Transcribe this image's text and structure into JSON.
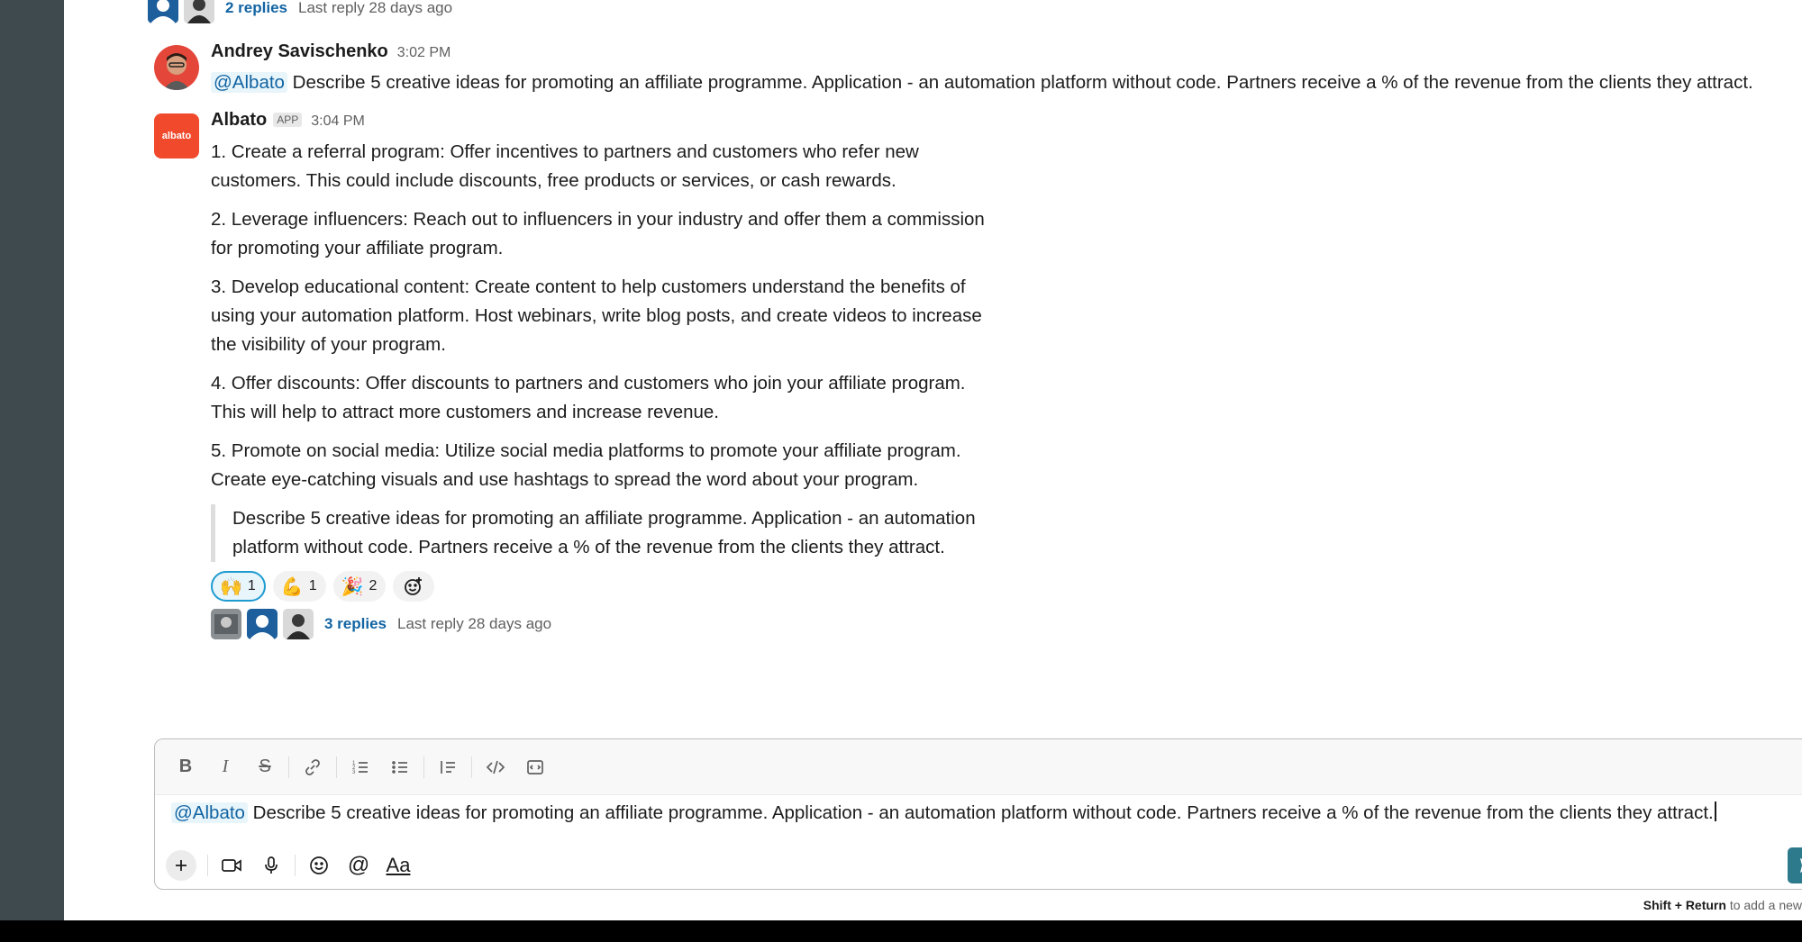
{
  "thread_top": {
    "replies": "2 replies",
    "last_reply": "Last reply 28 days ago"
  },
  "message_user": {
    "sender": "Andrey Savischenko",
    "time": "3:02 PM",
    "mention": "@Albato",
    "text": "Describe 5 creative ideas for promoting an affiliate programme. Application - an automation platform without code. Partners receive a % of the revenue from the clients they attract."
  },
  "message_bot": {
    "avatar_text": "albato",
    "sender": "Albato",
    "badge": "APP",
    "time": "3:04 PM",
    "paragraphs": [
      "1. Create a referral program: Offer incentives to partners and customers who refer new customers. This could include discounts, free products or services, or cash rewards.",
      "2. Leverage influencers: Reach out to influencers in your industry and offer them a commission for promoting your affiliate program.",
      "3. Develop educational content: Create content to help customers understand the benefits of using your automation platform. Host webinars, write blog posts, and create videos to increase the visibility of your program.",
      "4. Offer discounts: Offer discounts to partners and customers who join your affiliate program. This will help to attract more customers and increase revenue.",
      "5. Promote on social media: Utilize social media platforms to promote your affiliate program. Create eye-catching visuals and use hashtags to spread the word about your program."
    ],
    "quote": "Describe 5 creative ideas for promoting an affiliate programme. Application - an automation platform without code. Partners receive a % of the revenue from the clients they attract.",
    "reactions": [
      {
        "emoji": "🙌",
        "count": "1"
      },
      {
        "emoji": "💪",
        "count": "1"
      },
      {
        "emoji": "🎉",
        "count": "2"
      }
    ],
    "thread": {
      "replies": "3 replies",
      "last_reply": "Last reply 28 days ago"
    }
  },
  "composer": {
    "mention": "@Albato",
    "text": "Describe 5 creative ideas for promoting an affiliate programme. Application - an automation platform without code. Partners receive a % of the revenue from the clients they attract.",
    "toolbar_icons": [
      "bold-icon",
      "italic-icon",
      "strikethrough-icon",
      "link-icon",
      "ordered-list-icon",
      "bulleted-list-icon",
      "blockquote-icon",
      "code-icon",
      "code-block-icon"
    ],
    "actions": [
      "plus-icon",
      "video-icon",
      "microphone-icon",
      "emoji-icon",
      "mention-icon",
      "formatting-icon"
    ],
    "format_label": "Aa",
    "hint_key": "Shift + Return",
    "hint_text": "to add a new"
  },
  "colors": {
    "link": "#1264a3",
    "mention_bg": "#e8f5fa",
    "albato_brand": "#f0492c",
    "send": "#2c7a8c"
  }
}
